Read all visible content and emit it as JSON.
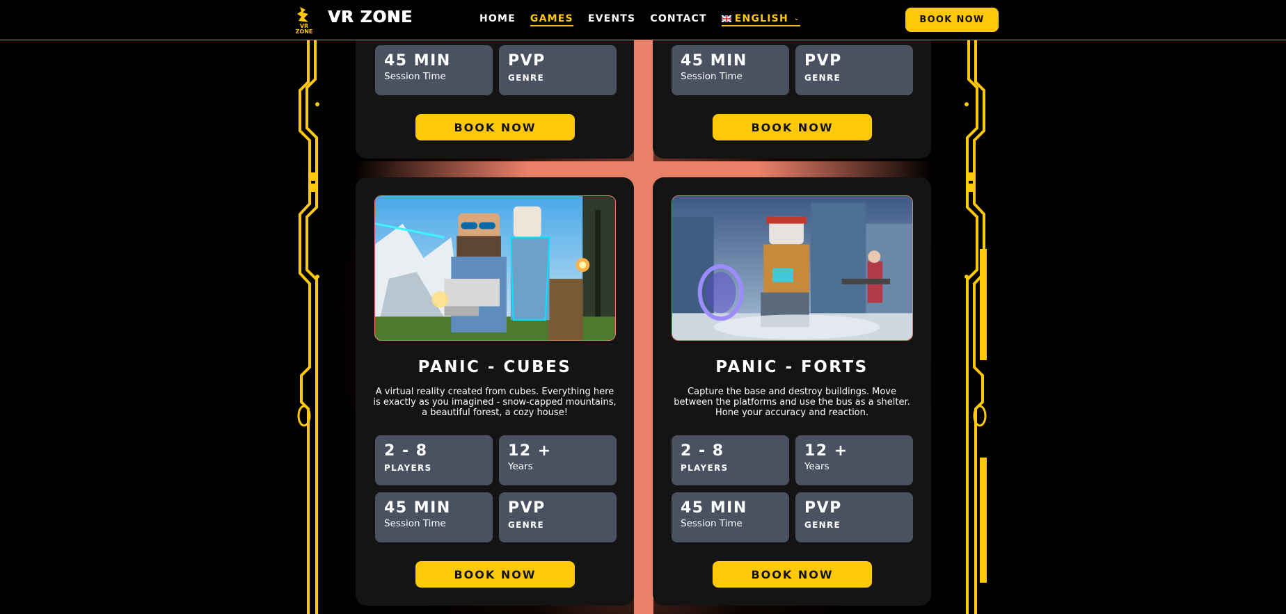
{
  "header": {
    "logo_text": "VR ZONE",
    "brand": "VR ZONE",
    "nav": [
      {
        "label": "HOME"
      },
      {
        "label": "GAMES"
      },
      {
        "label": "EVENTS"
      },
      {
        "label": "CONTACT"
      }
    ],
    "language": "ENGLISH",
    "book_label": "BOOK NOW"
  },
  "top_cards": [
    {
      "stats": [
        {
          "value": "45 MIN",
          "label": "Session Time"
        },
        {
          "value": "PVP",
          "label": "GENRE"
        }
      ],
      "book_label": "BOOK NOW"
    },
    {
      "stats": [
        {
          "value": "45 MIN",
          "label": "Session Time"
        },
        {
          "value": "PVP",
          "label": "GENRE"
        }
      ],
      "book_label": "BOOK NOW"
    }
  ],
  "games": [
    {
      "title": "PANIC - CUBES",
      "description": "A virtual reality created from cubes. Everything here is exactly as you imagined - snow-capped mountains, a beautiful forest, a cozy house!",
      "stats": [
        {
          "value": "2 - 8",
          "label": "PLAYERS"
        },
        {
          "value": "12 +",
          "label": "Years"
        },
        {
          "value": "45 MIN",
          "label": "Session Time"
        },
        {
          "value": "PVP",
          "label": "GENRE"
        }
      ],
      "book_label": "BOOK NOW"
    },
    {
      "title": "PANIC - FORTS",
      "description": "Capture the base and destroy buildings. Move between the platforms and use the bus as a shelter. Hone your accuracy and reaction.",
      "stats": [
        {
          "value": "2 - 8",
          "label": "PLAYERS"
        },
        {
          "value": "12 +",
          "label": "Years"
        },
        {
          "value": "45 MIN",
          "label": "Session Time"
        },
        {
          "value": "PVP",
          "label": "GENRE"
        }
      ],
      "book_label": "BOOK NOW"
    }
  ],
  "colors": {
    "accent": "#ffc80a",
    "glow": "#e8806a",
    "card": "#141414",
    "stat": "#4a5262"
  }
}
